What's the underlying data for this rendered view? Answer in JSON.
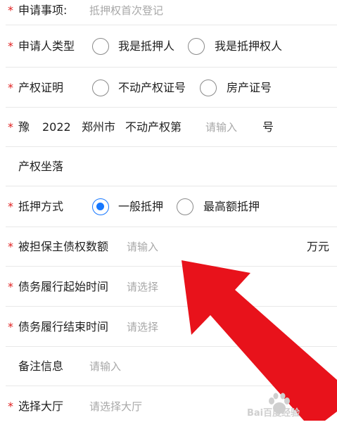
{
  "colors": {
    "accent": "#1677ff",
    "required": "#e02020",
    "arrow": "#e8121b",
    "placeholder": "#a8a8a8"
  },
  "rows": {
    "application": {
      "required": "*",
      "label": "申请事项:",
      "value": "抵押权首次登记"
    },
    "applicant_type": {
      "required": "*",
      "label": "申请人类型",
      "options": [
        "我是抵押人",
        "我是抵押权人"
      ],
      "selected": null
    },
    "property_proof": {
      "required": "*",
      "label": "产权证明",
      "options": [
        "不动产权证号",
        "房产证号"
      ],
      "selected": null
    },
    "cert_number": {
      "required": "*",
      "prefix": "豫",
      "year": "2022",
      "city": "郑州市",
      "kind": "不动产权第",
      "placeholder": "请输入",
      "suffix": "号"
    },
    "location": {
      "label": "产权坐落"
    },
    "mortgage_method": {
      "required": "*",
      "label": "抵押方式",
      "options": [
        "一般抵押",
        "最高额抵押"
      ],
      "selected": 0
    },
    "guaranteed_amount": {
      "required": "*",
      "label": "被担保主债权数额",
      "placeholder": "请输入",
      "unit": "万元"
    },
    "start_time": {
      "required": "*",
      "label": "债务履行起始时间",
      "placeholder": "请选择"
    },
    "end_time": {
      "required": "*",
      "label": "债务履行结束时间",
      "placeholder": "请选择"
    },
    "remarks": {
      "label": "备注信息",
      "placeholder": "请输入"
    },
    "hall": {
      "required": "*",
      "label": "选择大厅",
      "placeholder": "请选择大厅"
    }
  },
  "watermark": {
    "text": "Bai百度经验",
    "icon": "paw-icon"
  }
}
